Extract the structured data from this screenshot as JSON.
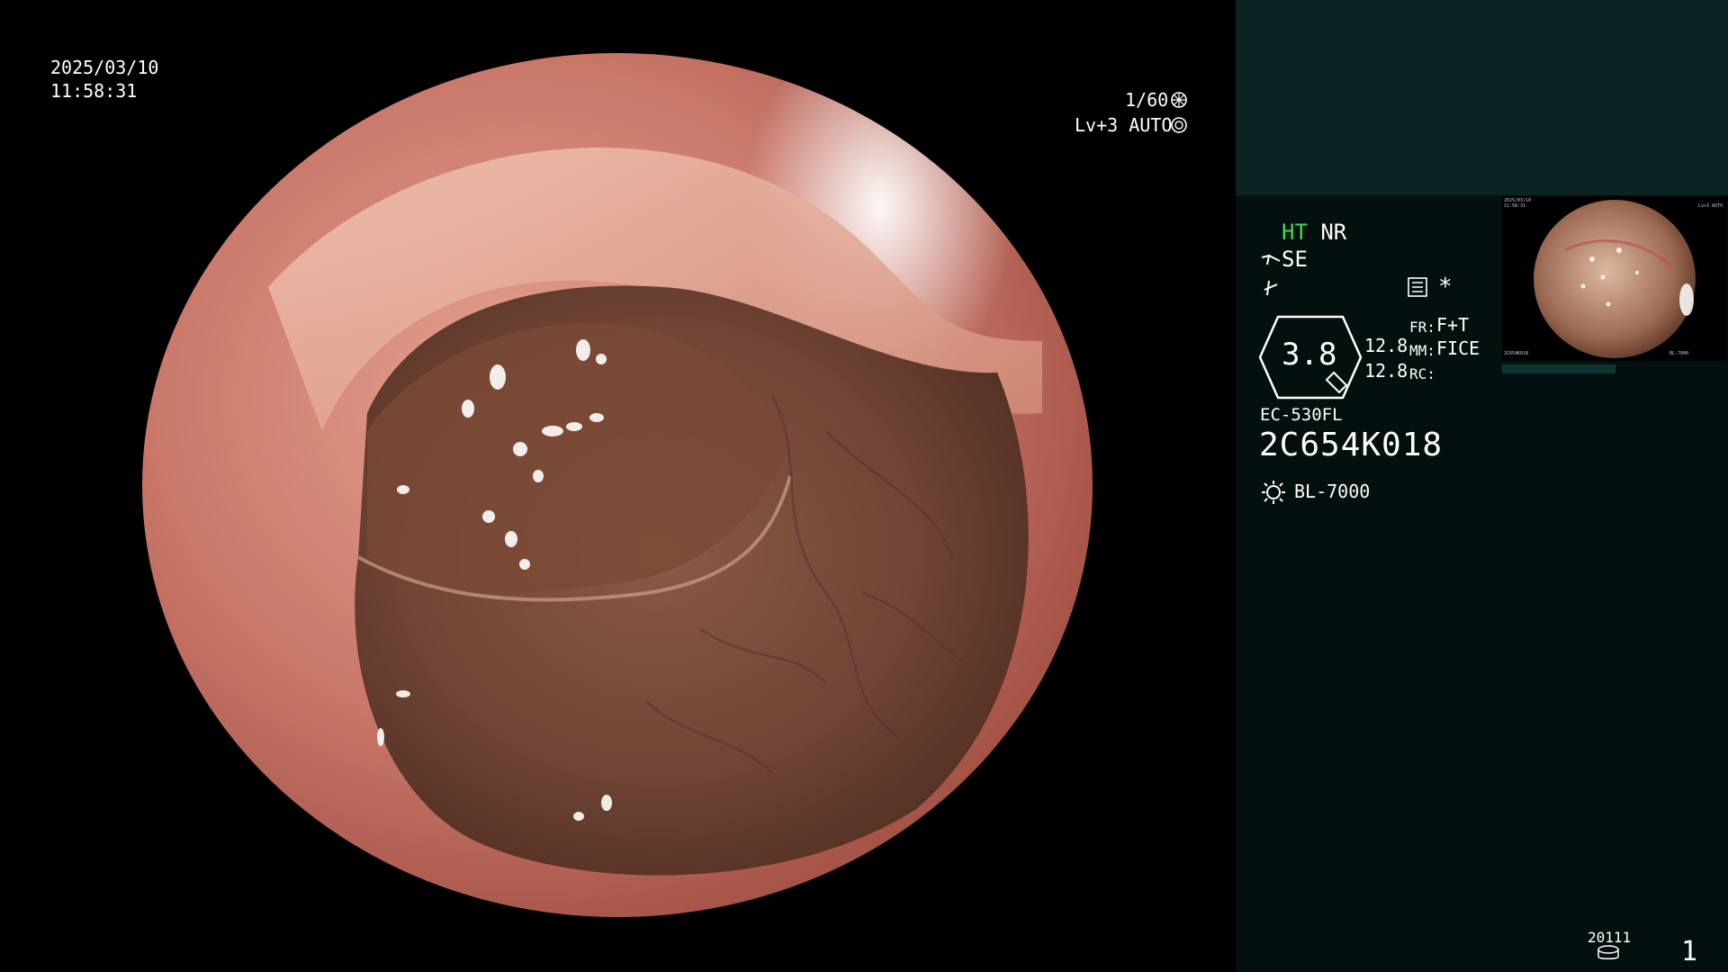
{
  "osd_left": {
    "date": "2025/03/10",
    "time": "11:58:31"
  },
  "osd_right": {
    "shutter": "1/60",
    "iris": "Lv+3 AUTO"
  },
  "panel": {
    "ht": "HT",
    "nr": "NR",
    "se": "SE",
    "asterisk": "*",
    "zoom_value": "3.8",
    "val_a": "12.8",
    "val_b": "12.8",
    "fr_label": "FR:",
    "fr_value": "F+T",
    "mm_label": "MM:",
    "mm_value": "FICE",
    "rc_label": "RC:",
    "scope_model": "EC-530FL",
    "scope_serial": "2C654K018",
    "light_source": "BL-7000",
    "storage_code": "20111",
    "page_number": "1"
  },
  "thumbnail": {
    "date": "2025/03/10",
    "time": "11:58:31",
    "serial": "2C654K018",
    "light": "BL-7000",
    "iris": "Lv+3 AUTO"
  },
  "colors": {
    "panel_bg": "#040f0f",
    "panel_top_bg": "#0c2323",
    "ht_accent": "#3cdc50",
    "mucosa": "#c07060",
    "lumen": "#6a4232"
  },
  "icons": [
    "shutter-icon",
    "iris-icon",
    "se-icon",
    "contrast-icon",
    "menu-icon",
    "zoom-badge-icon",
    "light-source-icon",
    "storage-icon"
  ]
}
